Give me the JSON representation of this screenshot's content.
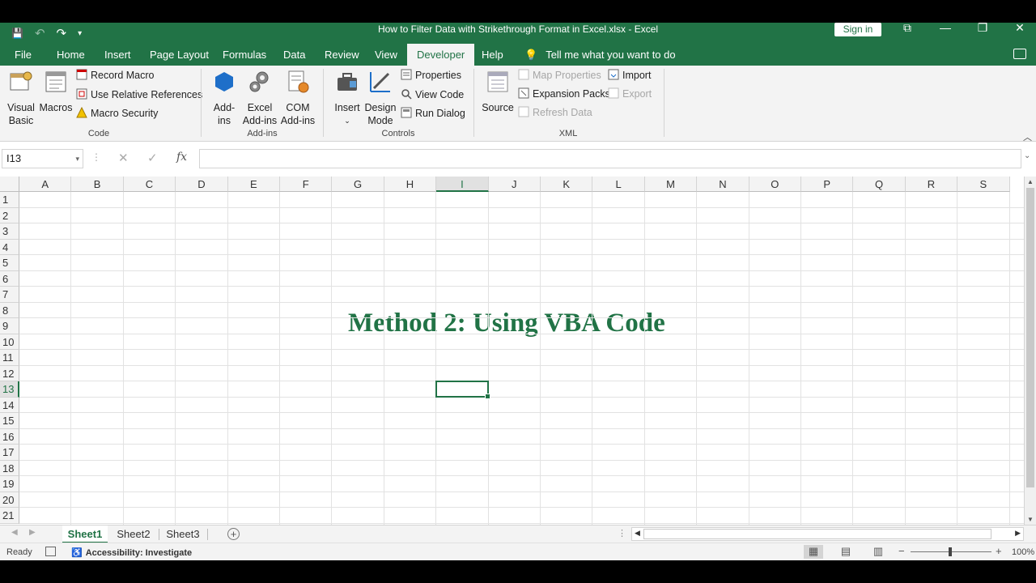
{
  "window": {
    "title": "How to Filter Data with Strikethrough Format in Excel.xlsx  -  Excel",
    "sign_in": "Sign in",
    "qat": {
      "save": "💾",
      "undo": "↶",
      "redo": "↷",
      "customize": "▾"
    },
    "controls": {
      "restore": "⧉",
      "minimize": "—",
      "maximize": "❐",
      "close": "✕"
    }
  },
  "tabs": [
    "File",
    "Home",
    "Insert",
    "Page Layout",
    "Formulas",
    "Data",
    "Review",
    "View",
    "Developer",
    "Help"
  ],
  "active_tab": "Developer",
  "tell_me": "Tell me what you want to do",
  "ribbon": {
    "code": {
      "label": "Code",
      "visual_basic": [
        "Visual",
        "Basic"
      ],
      "macros": "Macros",
      "record_macro": "Record Macro",
      "use_relative": "Use Relative References",
      "macro_security": "Macro Security"
    },
    "addins": {
      "label": "Add-ins",
      "addins": [
        "Add-",
        "ins"
      ],
      "excel_addins": [
        "Excel",
        "Add-ins"
      ],
      "com_addins": [
        "COM",
        "Add-ins"
      ]
    },
    "controls": {
      "label": "Controls",
      "insert": "Insert",
      "design_mode": [
        "Design",
        "Mode"
      ],
      "properties": "Properties",
      "view_code": "View Code",
      "run_dialog": "Run Dialog"
    },
    "xml": {
      "label": "XML",
      "source": "Source",
      "map_properties": "Map Properties",
      "expansion_packs": "Expansion Packs",
      "refresh_data": "Refresh Data",
      "import": "Import",
      "export": "Export"
    }
  },
  "formula_bar": {
    "name_box": "I13",
    "cancel": "✕",
    "enter": "✓",
    "fx": "fx",
    "value": ""
  },
  "grid": {
    "columns": [
      "A",
      "B",
      "C",
      "D",
      "E",
      "F",
      "G",
      "H",
      "I",
      "J",
      "K",
      "L",
      "M",
      "N",
      "O",
      "P",
      "Q",
      "R",
      "S"
    ],
    "rows": [
      "1",
      "2",
      "3",
      "4",
      "5",
      "6",
      "7",
      "8",
      "9",
      "10",
      "11",
      "12",
      "13",
      "14",
      "15",
      "16",
      "17",
      "18",
      "19",
      "20",
      "21"
    ],
    "selected_cell": "I13",
    "selected_column": "I",
    "selected_row": "13"
  },
  "overlay_title": "Method 2: Using VBA Code",
  "sheets": [
    "Sheet1",
    "Sheet2",
    "Sheet3"
  ],
  "active_sheet": "Sheet1",
  "status": {
    "ready": "Ready",
    "accessibility": "Accessibility: Investigate",
    "zoom": "100%"
  }
}
